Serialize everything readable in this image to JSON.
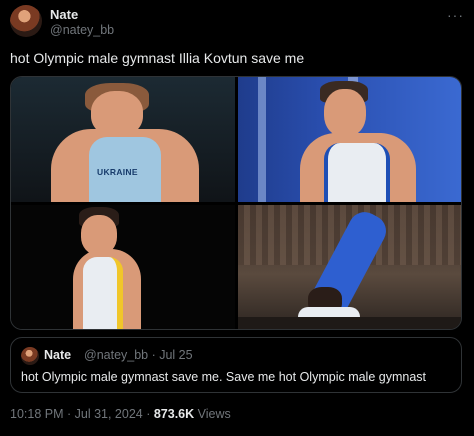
{
  "author": {
    "name": "Nate",
    "handle": "@natey_bb"
  },
  "more_icon": "more-icon",
  "tweet": {
    "text": "hot Olympic male gymnast Illia Kovtun save me"
  },
  "media": {
    "jersey_text": "UKRAINE"
  },
  "quoted": {
    "name": "Nate",
    "meta": "@natey_bb · Jul 25",
    "text": "hot Olympic male gymnast save me. Save me hot Olympic male gymnast"
  },
  "footer": {
    "time": "10:18 PM · Jul 31, 2024 · ",
    "views_count": "873.6K",
    "views_label": " Views"
  },
  "colors": {
    "background": "#000000",
    "text": "#e7e9ea",
    "muted": "#71767b",
    "border": "#2f3336"
  }
}
